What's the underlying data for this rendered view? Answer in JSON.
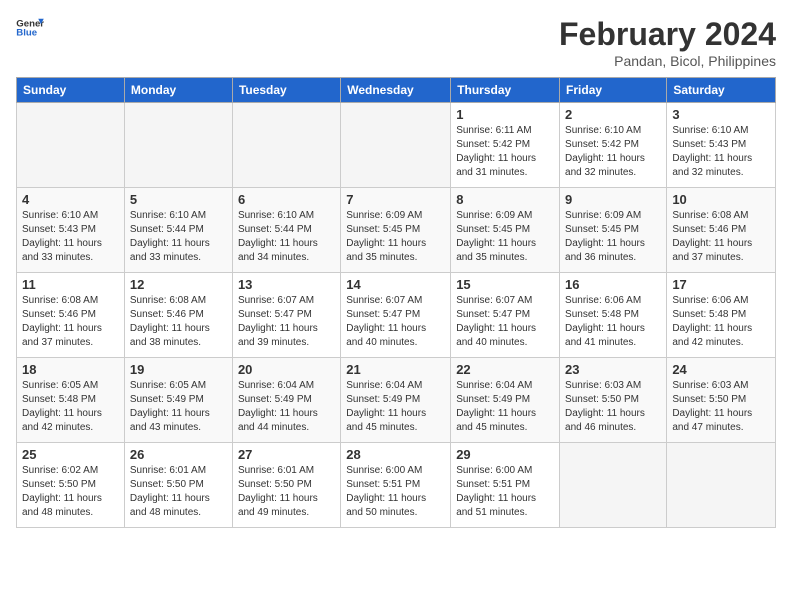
{
  "header": {
    "logo_general": "General",
    "logo_blue": "Blue",
    "month_year": "February 2024",
    "location": "Pandan, Bicol, Philippines"
  },
  "days_of_week": [
    "Sunday",
    "Monday",
    "Tuesday",
    "Wednesday",
    "Thursday",
    "Friday",
    "Saturday"
  ],
  "weeks": [
    [
      {
        "day": "",
        "info": ""
      },
      {
        "day": "",
        "info": ""
      },
      {
        "day": "",
        "info": ""
      },
      {
        "day": "",
        "info": ""
      },
      {
        "day": "1",
        "info": "Sunrise: 6:11 AM\nSunset: 5:42 PM\nDaylight: 11 hours\nand 31 minutes."
      },
      {
        "day": "2",
        "info": "Sunrise: 6:10 AM\nSunset: 5:42 PM\nDaylight: 11 hours\nand 32 minutes."
      },
      {
        "day": "3",
        "info": "Sunrise: 6:10 AM\nSunset: 5:43 PM\nDaylight: 11 hours\nand 32 minutes."
      }
    ],
    [
      {
        "day": "4",
        "info": "Sunrise: 6:10 AM\nSunset: 5:43 PM\nDaylight: 11 hours\nand 33 minutes."
      },
      {
        "day": "5",
        "info": "Sunrise: 6:10 AM\nSunset: 5:44 PM\nDaylight: 11 hours\nand 33 minutes."
      },
      {
        "day": "6",
        "info": "Sunrise: 6:10 AM\nSunset: 5:44 PM\nDaylight: 11 hours\nand 34 minutes."
      },
      {
        "day": "7",
        "info": "Sunrise: 6:09 AM\nSunset: 5:45 PM\nDaylight: 11 hours\nand 35 minutes."
      },
      {
        "day": "8",
        "info": "Sunrise: 6:09 AM\nSunset: 5:45 PM\nDaylight: 11 hours\nand 35 minutes."
      },
      {
        "day": "9",
        "info": "Sunrise: 6:09 AM\nSunset: 5:45 PM\nDaylight: 11 hours\nand 36 minutes."
      },
      {
        "day": "10",
        "info": "Sunrise: 6:08 AM\nSunset: 5:46 PM\nDaylight: 11 hours\nand 37 minutes."
      }
    ],
    [
      {
        "day": "11",
        "info": "Sunrise: 6:08 AM\nSunset: 5:46 PM\nDaylight: 11 hours\nand 37 minutes."
      },
      {
        "day": "12",
        "info": "Sunrise: 6:08 AM\nSunset: 5:46 PM\nDaylight: 11 hours\nand 38 minutes."
      },
      {
        "day": "13",
        "info": "Sunrise: 6:07 AM\nSunset: 5:47 PM\nDaylight: 11 hours\nand 39 minutes."
      },
      {
        "day": "14",
        "info": "Sunrise: 6:07 AM\nSunset: 5:47 PM\nDaylight: 11 hours\nand 40 minutes."
      },
      {
        "day": "15",
        "info": "Sunrise: 6:07 AM\nSunset: 5:47 PM\nDaylight: 11 hours\nand 40 minutes."
      },
      {
        "day": "16",
        "info": "Sunrise: 6:06 AM\nSunset: 5:48 PM\nDaylight: 11 hours\nand 41 minutes."
      },
      {
        "day": "17",
        "info": "Sunrise: 6:06 AM\nSunset: 5:48 PM\nDaylight: 11 hours\nand 42 minutes."
      }
    ],
    [
      {
        "day": "18",
        "info": "Sunrise: 6:05 AM\nSunset: 5:48 PM\nDaylight: 11 hours\nand 42 minutes."
      },
      {
        "day": "19",
        "info": "Sunrise: 6:05 AM\nSunset: 5:49 PM\nDaylight: 11 hours\nand 43 minutes."
      },
      {
        "day": "20",
        "info": "Sunrise: 6:04 AM\nSunset: 5:49 PM\nDaylight: 11 hours\nand 44 minutes."
      },
      {
        "day": "21",
        "info": "Sunrise: 6:04 AM\nSunset: 5:49 PM\nDaylight: 11 hours\nand 45 minutes."
      },
      {
        "day": "22",
        "info": "Sunrise: 6:04 AM\nSunset: 5:49 PM\nDaylight: 11 hours\nand 45 minutes."
      },
      {
        "day": "23",
        "info": "Sunrise: 6:03 AM\nSunset: 5:50 PM\nDaylight: 11 hours\nand 46 minutes."
      },
      {
        "day": "24",
        "info": "Sunrise: 6:03 AM\nSunset: 5:50 PM\nDaylight: 11 hours\nand 47 minutes."
      }
    ],
    [
      {
        "day": "25",
        "info": "Sunrise: 6:02 AM\nSunset: 5:50 PM\nDaylight: 11 hours\nand 48 minutes."
      },
      {
        "day": "26",
        "info": "Sunrise: 6:01 AM\nSunset: 5:50 PM\nDaylight: 11 hours\nand 48 minutes."
      },
      {
        "day": "27",
        "info": "Sunrise: 6:01 AM\nSunset: 5:50 PM\nDaylight: 11 hours\nand 49 minutes."
      },
      {
        "day": "28",
        "info": "Sunrise: 6:00 AM\nSunset: 5:51 PM\nDaylight: 11 hours\nand 50 minutes."
      },
      {
        "day": "29",
        "info": "Sunrise: 6:00 AM\nSunset: 5:51 PM\nDaylight: 11 hours\nand 51 minutes."
      },
      {
        "day": "",
        "info": ""
      },
      {
        "day": "",
        "info": ""
      }
    ]
  ]
}
